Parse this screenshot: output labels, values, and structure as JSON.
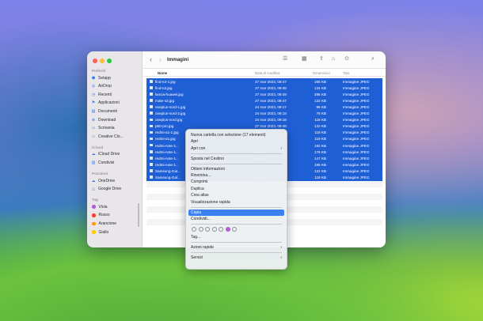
{
  "window": {
    "title": "Immagini",
    "nav": {
      "back": "‹",
      "forward": "›"
    }
  },
  "toolbar_icons": [
    "list-view-icon",
    "grid-view-icon",
    "share-icon",
    "tag-icon",
    "more-icon",
    "search-icon"
  ],
  "sidebar": {
    "sections": [
      {
        "label": "Preferiti",
        "items": [
          {
            "label": "Setapp",
            "icon": "setapp-icon"
          },
          {
            "label": "AirDrop",
            "icon": "airdrop-icon"
          },
          {
            "label": "Recenti",
            "icon": "clock-icon"
          },
          {
            "label": "Applicazioni",
            "icon": "apps-icon"
          },
          {
            "label": "Documenti",
            "icon": "document-icon"
          },
          {
            "label": "Download",
            "icon": "download-icon"
          },
          {
            "label": "Scrivania",
            "icon": "desktop-icon"
          },
          {
            "label": "Creative Clo...",
            "icon": "folder-icon"
          }
        ]
      },
      {
        "label": "iCloud",
        "items": [
          {
            "label": "iCloud Drive",
            "icon": "cloud-icon"
          },
          {
            "label": "Condivisi",
            "icon": "shared-folder-icon"
          }
        ]
      },
      {
        "label": "Posizioni",
        "items": [
          {
            "label": "OneDrive",
            "icon": "cloud-icon"
          },
          {
            "label": "Google Drive",
            "icon": "drive-icon"
          }
        ]
      },
      {
        "label": "Tag",
        "items": [
          {
            "label": "Viola",
            "color": "#b25dd8"
          },
          {
            "label": "Rosso",
            "color": "#ff3b30"
          },
          {
            "label": "Arancione",
            "color": "#ff9500"
          },
          {
            "label": "Giallo",
            "color": "#ffcc00"
          }
        ]
      }
    ]
  },
  "columns": {
    "name": "Nome",
    "date": "Data di modifica",
    "size": "Dimensioni",
    "kind": "Tipo"
  },
  "files": [
    {
      "name": "find-n3-1.jpg",
      "date": "27 mar 2023, 09:47",
      "size": "165 KB",
      "kind": "Immagine JPEG"
    },
    {
      "name": "find-n3.jpg",
      "date": "27 mar 2023, 09:48",
      "size": "124 KB",
      "kind": "Immagine JPEG"
    },
    {
      "name": "lancia-huawei.jpg",
      "date": "27 mar 2023, 09:49",
      "size": "386 KB",
      "kind": "Immagine JPEG"
    },
    {
      "name": "mate-x3.jpg",
      "date": "27 mar 2023, 09:47",
      "size": "122 KB",
      "kind": "Immagine JPEG"
    },
    {
      "name": "oneplus-nord-1.jpg",
      "date": "24 mar 2023, 09:17",
      "size": "96 KB",
      "kind": "Immagine JPEG"
    },
    {
      "name": "oneplus-nord-2.jpg",
      "date": "24 mar 2023, 09:18",
      "size": "76 KB",
      "kind": "Immagine JPEG"
    },
    {
      "name": "oneplus-nord.jpg",
      "date": "24 mar 2023, 09:18",
      "size": "118 KB",
      "kind": "Immagine JPEG"
    },
    {
      "name": "p60-pro.jpg",
      "date": "27 mar 2023, 09:48",
      "size": "122 KB",
      "kind": "Immagine JPEG"
    },
    {
      "name": "redmi-a1-1.jpg",
      "date": "...45",
      "size": "118 KB",
      "kind": "Immagine JPEG"
    },
    {
      "name": "redmi-a1.jpg",
      "date": "...45",
      "size": "119 KB",
      "kind": "Immagine JPEG"
    },
    {
      "name": "redmi-note-1...",
      "date": "...32",
      "size": "192 KB",
      "kind": "Immagine JPEG"
    },
    {
      "name": "redmi-note-1...",
      "date": "...32",
      "size": "176 KB",
      "kind": "Immagine JPEG"
    },
    {
      "name": "redmi-note-1...",
      "date": "...32",
      "size": "147 KB",
      "kind": "Immagine JPEG"
    },
    {
      "name": "redmi-note-1...",
      "date": "...32",
      "size": "185 KB",
      "kind": "Immagine JPEG"
    },
    {
      "name": "Samsung-Gal...",
      "date": "...20",
      "size": "122 KB",
      "kind": "Immagine JPEG"
    },
    {
      "name": "Samsung-Gal...",
      "date": "...20",
      "size": "118 KB",
      "kind": "Immagine JPEG"
    }
  ],
  "context_menu": {
    "items": [
      {
        "label": "Nuova cartella con selezione (17 elementi)"
      },
      {
        "label": "Apri"
      },
      {
        "label": "Apri con",
        "submenu": true
      },
      {
        "separator": true
      },
      {
        "label": "Sposta nel Cestino"
      },
      {
        "separator": true
      },
      {
        "label": "Ottieni informazioni"
      },
      {
        "label": "Rinomina..."
      },
      {
        "label": "Comprimi"
      },
      {
        "label": "Duplica"
      },
      {
        "label": "Crea alias"
      },
      {
        "label": "Visualizzazione rapida"
      },
      {
        "separator": true
      },
      {
        "label": "Copia",
        "highlighted": true
      },
      {
        "label": "Condividi..."
      },
      {
        "separator": true
      },
      {
        "tags": true
      },
      {
        "label": "Tag..."
      },
      {
        "separator": true
      },
      {
        "label": "Azioni rapide",
        "submenu": true
      },
      {
        "separator": true
      },
      {
        "label": "Servizi",
        "submenu": true
      }
    ],
    "tag_colors": [
      "none",
      "none",
      "none",
      "none",
      "none",
      "#b25dd8",
      "none"
    ]
  }
}
